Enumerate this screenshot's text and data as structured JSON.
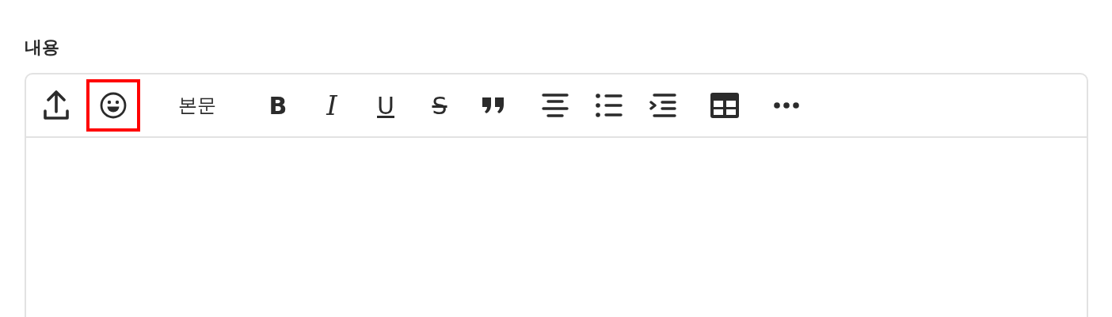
{
  "field_label": "내용",
  "toolbar_groups": [
    [
      {
        "kind": "upload",
        "highlighted": false
      },
      {
        "kind": "emoji",
        "highlighted": true
      }
    ],
    [
      {
        "kind": "text-style",
        "label": "본문",
        "highlighted": false
      }
    ],
    [
      {
        "kind": "bold",
        "glyph": "B",
        "highlighted": false
      },
      {
        "kind": "italic",
        "glyph": "I",
        "highlighted": false
      },
      {
        "kind": "underline",
        "glyph": "U",
        "highlighted": false
      },
      {
        "kind": "strike",
        "glyph": "S",
        "highlighted": false
      },
      {
        "kind": "quote",
        "highlighted": false
      }
    ],
    [
      {
        "kind": "align",
        "highlighted": false
      },
      {
        "kind": "bullets",
        "highlighted": false
      },
      {
        "kind": "indent",
        "highlighted": false
      }
    ],
    [
      {
        "kind": "table",
        "highlighted": false
      }
    ],
    [
      {
        "kind": "more",
        "highlighted": false
      }
    ]
  ]
}
